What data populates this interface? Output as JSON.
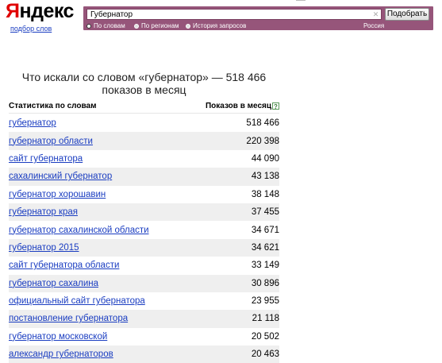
{
  "logo": {
    "first_letter": "Я",
    "rest": "ндекс",
    "subtitle": "подбор слов"
  },
  "search": {
    "value": "Губернатор",
    "clear_icon": "✕",
    "submit_label": "Подобрать",
    "modes": [
      {
        "label": "По словам",
        "selected": true
      },
      {
        "label": "По регионам",
        "selected": false
      },
      {
        "label": "История запросов",
        "selected": false
      }
    ],
    "region": "Россия"
  },
  "colors": {
    "search_bar": "#96557a",
    "link": "#1a3dc1",
    "logo_accent": "#e00000",
    "row_alt": "#efefef"
  },
  "results": {
    "title": "Что искали со словом «губернатор» — 518 466 показов в месяц",
    "col_keyword": "Статистика по словам",
    "col_count": "Показов в месяц",
    "help_icon": "?",
    "rows": [
      {
        "keyword": "губернатор",
        "count": "518 466"
      },
      {
        "keyword": "губернатор области",
        "count": "220 398"
      },
      {
        "keyword": "сайт губернатора",
        "count": "44 090"
      },
      {
        "keyword": "сахалинский губернатор",
        "count": "43 138"
      },
      {
        "keyword": "губернатор хорошавин",
        "count": "38 148"
      },
      {
        "keyword": "губернатор края",
        "count": "37 455"
      },
      {
        "keyword": "губернатор сахалинской области",
        "count": "34 671"
      },
      {
        "keyword": "губернатор 2015",
        "count": "34 621"
      },
      {
        "keyword": "сайт губернатора области",
        "count": "33 149"
      },
      {
        "keyword": "губернатор сахалина",
        "count": "30 896"
      },
      {
        "keyword": "официальный сайт губернатора",
        "count": "23 955"
      },
      {
        "keyword": "постановление губернатора",
        "count": "21 118"
      },
      {
        "keyword": "губернатор московской",
        "count": "20 502"
      },
      {
        "keyword": "александр губернаторов",
        "count": "20 463"
      }
    ]
  }
}
